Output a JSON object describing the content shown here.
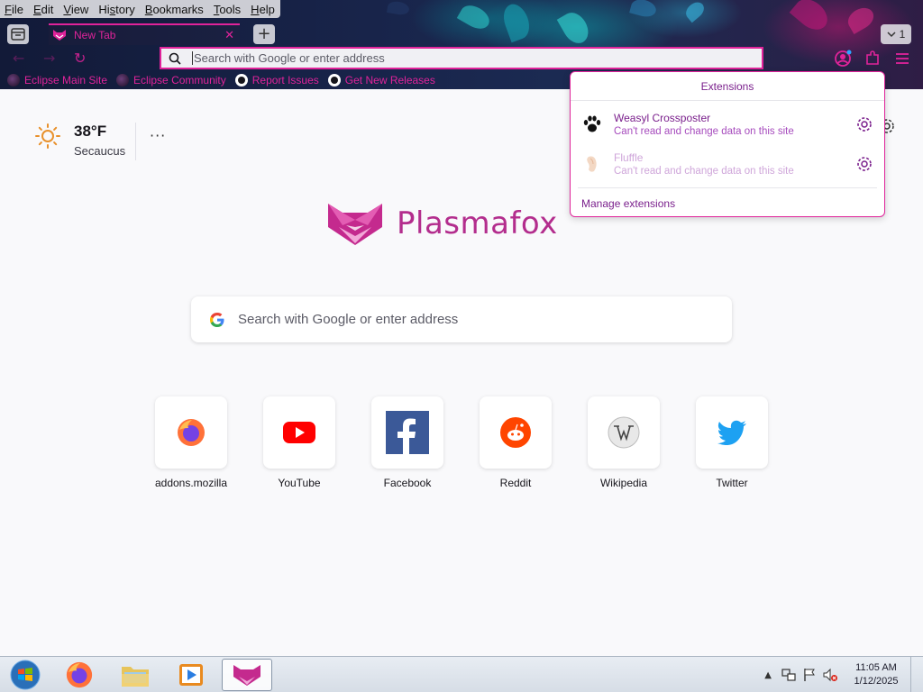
{
  "menubar": {
    "items": [
      {
        "prefix": "",
        "key": "F",
        "rest": "ile"
      },
      {
        "prefix": "",
        "key": "E",
        "rest": "dit"
      },
      {
        "prefix": "",
        "key": "V",
        "rest": "iew"
      },
      {
        "prefix": "Hi",
        "key": "s",
        "rest": "tory"
      },
      {
        "prefix": "",
        "key": "B",
        "rest": "ookmarks"
      },
      {
        "prefix": "",
        "key": "T",
        "rest": "ools"
      },
      {
        "prefix": "",
        "key": "H",
        "rest": "elp"
      }
    ]
  },
  "tab": {
    "title": "New Tab",
    "count": "1"
  },
  "urlbar": {
    "placeholder": "Search with Google or enter address"
  },
  "bookmarks": [
    "Eclipse Main Site",
    "Eclipse Community",
    "Report Issues",
    "Get New Releases"
  ],
  "weather": {
    "temp": "38°F",
    "city": "Secaucus",
    "more": "···"
  },
  "logo": {
    "text": "Plasmafox"
  },
  "search": {
    "placeholder": "Search with Google or enter address"
  },
  "topsites": [
    {
      "label": "addons.mozilla",
      "icon": "firefox-icon"
    },
    {
      "label": "YouTube",
      "icon": "youtube-icon"
    },
    {
      "label": "Facebook",
      "icon": "facebook-icon"
    },
    {
      "label": "Reddit",
      "icon": "reddit-icon"
    },
    {
      "label": "Wikipedia",
      "icon": "wikipedia-icon"
    },
    {
      "label": "Twitter",
      "icon": "twitter-icon"
    }
  ],
  "extensions": {
    "header": "Extensions",
    "items": [
      {
        "name": "Weasyl Crossposter",
        "desc": "Can't read and change data on this site",
        "icon": "paw-icon"
      },
      {
        "name": "Fluffle",
        "desc": "Can't read and change data on this site",
        "icon": "fluffle-icon"
      }
    ],
    "manage": "Manage extensions"
  },
  "taskbar": {
    "apps": [
      "start-orb",
      "firefox",
      "file-explorer",
      "media-player",
      "plasmafox"
    ],
    "clock_time": "11:05 AM",
    "clock_date": "1/12/2025"
  },
  "colors": {
    "accent": "#e0239a",
    "panel_text": "#7a1f8c",
    "brand": "#b32d8d"
  }
}
